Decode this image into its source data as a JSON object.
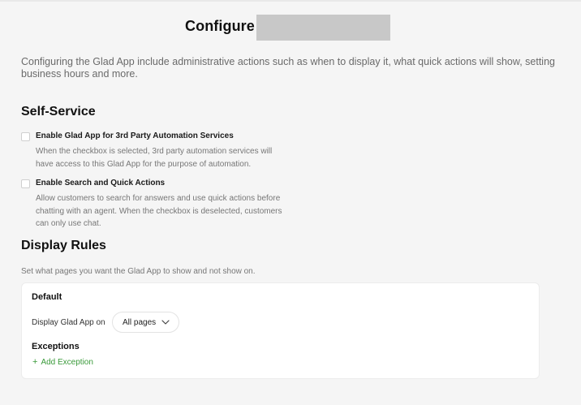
{
  "header": {
    "title": "Configure"
  },
  "intro_text": "Configuring the Glad App include administrative actions such as when to display it, what quick actions will show, setting business hours and more.",
  "self_service": {
    "title": "Self-Service",
    "options": [
      {
        "label": "Enable Glad App for 3rd Party Automation Services",
        "description": "When the checkbox is selected, 3rd party automation services will have access to this Glad App for the purpose of automation.",
        "checked": false
      },
      {
        "label": "Enable Search and Quick Actions",
        "description": "Allow customers to search for answers and use quick actions before chatting with an agent. When the checkbox is deselected, customers can only use chat.",
        "checked": false
      }
    ]
  },
  "display_rules": {
    "title": "Display Rules",
    "description": "Set what pages you want the Glad App to show and not show on.",
    "default_heading": "Default",
    "display_label": "Display Glad App on",
    "display_value": "All pages",
    "exceptions_heading": "Exceptions",
    "add_exception_label": "Add Exception",
    "accent_color": "#3a9a3a"
  },
  "icons": {
    "select_chevron": "chevron-down-icon",
    "add": "plus-icon"
  }
}
